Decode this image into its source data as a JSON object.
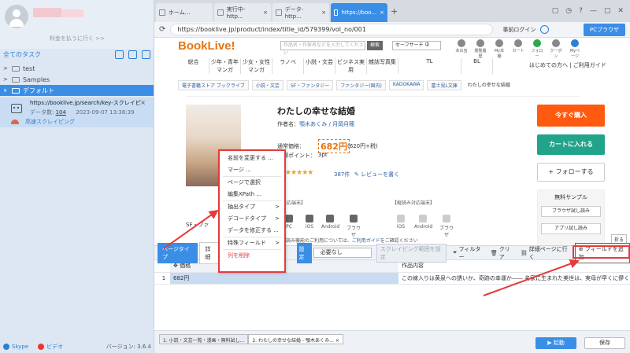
{
  "sidebar": {
    "pay_link": "料金を払うに行く >>",
    "all_tasks": "全てのタスク",
    "tree": [
      {
        "label": "test",
        "chev": ">"
      },
      {
        "label": "Samples",
        "chev": ">"
      },
      {
        "label": "デフォルト",
        "chev": "∨"
      }
    ],
    "task": {
      "url": "https://booklive.jp/search/key-スクレイピング",
      "count_label": "データ数:",
      "count": "104",
      "timestamp": "2023-09-07 13:38:39",
      "close": "×",
      "speed": "高速スクレイピング"
    },
    "footer": {
      "skype": "Skype",
      "video": "ビデオ",
      "version": "バージョン: 3.6.4"
    }
  },
  "browser": {
    "tabs": [
      {
        "label": "ホーム...",
        "x": ""
      },
      {
        "label": "実行中-http...",
        "x": "×"
      },
      {
        "label": "データ-http...",
        "x": "×"
      },
      {
        "label": "https://boo...",
        "x": "×"
      }
    ],
    "plus": "+",
    "url": "https://booklive.jp/product/index/title_id/579399/vol_no/001",
    "login": "事前ログイン",
    "pc_browser": "PCブラウザ",
    "win": [
      "▢",
      "◷",
      "?",
      "—",
      "▢",
      "✕"
    ]
  },
  "webpage": {
    "logo": "BookLive!",
    "search_placeholder": "作品名・作家名などを入力してください",
    "search_btn": "検索",
    "safe_search": "セーフサーチ 中",
    "top_icons": [
      "本の虫",
      "閲覧履歴",
      "My本棚",
      "カート",
      "フォロー",
      "クーポン",
      "Myページ"
    ],
    "nav": [
      "総合",
      "少年・青年マンガ",
      "少女・女性マンガ",
      "ラノベ",
      "小説・文芸",
      "ビジネス実用",
      "雑誌写真集",
      "TL",
      "BL"
    ],
    "nav_right": "はじめての方へ  |  ご利用ガイド",
    "crumbs": [
      "電子書籍ストア ブックライブ",
      "小説・文芸",
      "SF・ファンタジー",
      "ファンタジー(国内)",
      "KADOKAWA",
      "富士見L文庫"
    ],
    "crumb_last": "わたしの幸せな結婚",
    "title": "わたしの幸せな結婚",
    "author_label": "作者名：",
    "author": "顎木あくみ / 月岡月穂",
    "price_label": "通常価格：",
    "price": "682円",
    "price_tax": "(620円+税)",
    "point_label": "獲得ポイント：",
    "point": "3pt",
    "stars": "★★★★★",
    "review_count": "387件",
    "review_write": "✎ レビューを書く",
    "device_left": "【対応端末】",
    "device_right": "【縦読み対応端末】",
    "devices": [
      "PC",
      "iOS",
      "Android",
      "ブラウザ"
    ],
    "devices_v": [
      "iOS",
      "Android",
      "ブラウザ"
    ],
    "func_note": "※縦読み機能のご利用については、",
    "func_link": "ご利用ガイド",
    "func_tail": "をご確認ください",
    "sf_tag": "SF・ファ",
    "buy": "今すぐ購入",
    "cart": "カートに入れる",
    "follow": "+ フォローする",
    "sample_title": "無料サンプル",
    "sample_btns": [
      "ブラウザ試し読み",
      "アプリ試し読み"
    ],
    "fold": "折る"
  },
  "context_menu": {
    "items": [
      "名前を変更する ...",
      "マージ ...",
      "ページで選択",
      "編集XPath ...",
      "抽出タイプ",
      "デコードタイプ",
      "データを修正する ...",
      "特殊フィールド",
      "列を削除"
    ],
    "arrow": ">"
  },
  "panel": {
    "page_type": "ページタイプ",
    "detail": "詳細",
    "setting": "設定",
    "select": "必要なし",
    "scrape_range": "スクレイピング範囲を設定",
    "filter": "フィルター",
    "clear": "クリア",
    "goto_detail": "詳細ページに行く",
    "add_field": "⊕ フィールドを追加",
    "col1": "価格",
    "col2": "作品内容",
    "row_num": "1",
    "row_val": "682円",
    "row_desc": "この嫁入りは黄泉への誘いか、奇跡の幸運か―― 名家に生まれた美世は、実母が早くに儚く"
  },
  "bottom": {
    "tabs": [
      "1. 小説・文芸一覧・漫画・無料試し...",
      "2. わたしの幸せな結婚 - 顎木あくみ..."
    ],
    "close": "×",
    "launch": "▶ 起動",
    "save": "保存"
  }
}
